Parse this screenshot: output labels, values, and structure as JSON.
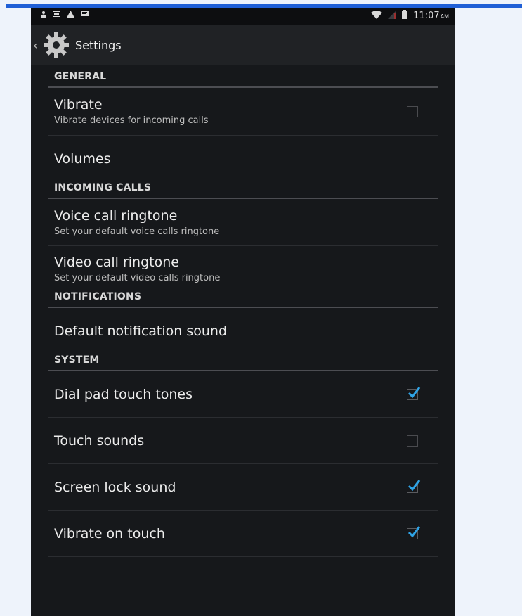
{
  "status_bar": {
    "time": "11:07",
    "ampm": "AM",
    "left_icons": [
      "person-icon",
      "screen-icon",
      "warning-icon",
      "message-icon"
    ],
    "right_icons": [
      "wifi-icon",
      "signal-icon",
      "battery-icon"
    ]
  },
  "action_bar": {
    "title": "Settings"
  },
  "sections": {
    "general": "GENERAL",
    "incoming_calls": "INCOMING CALLS",
    "notifications": "NOTIFICATIONS",
    "system": "SYSTEM"
  },
  "items": {
    "vibrate": {
      "title": "Vibrate",
      "subtitle": "Vibrate devices for incoming calls",
      "checked": false
    },
    "volumes": {
      "title": "Volumes"
    },
    "voice_ringtone": {
      "title": "Voice call ringtone",
      "subtitle": "Set your default voice calls ringtone"
    },
    "video_ringtone": {
      "title": "Video call ringtone",
      "subtitle": "Set your default video calls ringtone"
    },
    "default_notification": {
      "title": "Default notification sound"
    },
    "dial_pad": {
      "title": "Dial pad touch tones",
      "checked": true
    },
    "touch_sounds": {
      "title": "Touch sounds",
      "checked": false
    },
    "screen_lock": {
      "title": "Screen lock sound",
      "checked": true
    },
    "vibrate_touch": {
      "title": "Vibrate on touch",
      "checked": true
    }
  },
  "colors": {
    "accent": "#2fa3e6",
    "background": "#16181b",
    "action_bar": "#202225",
    "page_bg": "#eef3fb",
    "top_bar": "#1f5fd6"
  }
}
